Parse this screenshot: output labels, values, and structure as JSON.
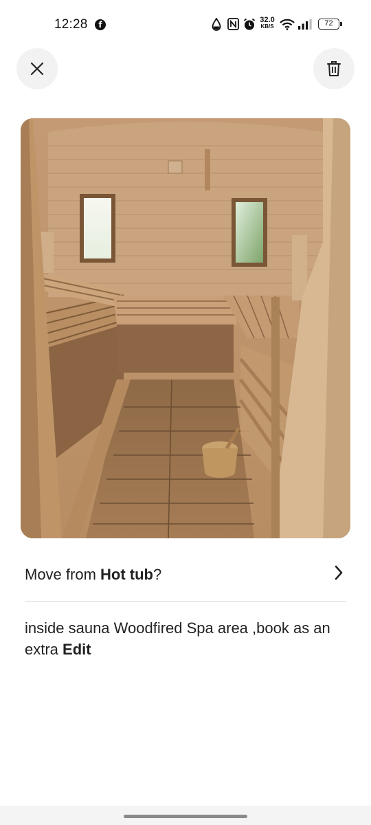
{
  "status_bar": {
    "time": "12:28",
    "app_icon": "facebook-icon",
    "net_speed_value": "32.0",
    "net_speed_unit": "KB/S",
    "battery": "72",
    "icons": [
      "water-drop-icon",
      "nfc-icon",
      "alarm-icon",
      "wifi-icon",
      "signal-icon",
      "battery-icon"
    ]
  },
  "toolbar": {
    "close_icon": "close-icon",
    "delete_icon": "trash-icon"
  },
  "photo": {
    "subject": "sauna-interior-photo"
  },
  "move": {
    "prefix": "Move from ",
    "room": "Hot tub",
    "suffix": "?",
    "chevron_icon": "chevron-right-icon"
  },
  "caption": {
    "text": "inside sauna Woodfired Spa area ,book as an extra ",
    "edit_label": "Edit"
  },
  "colors": {
    "text": "#222222",
    "divider": "#dddddd",
    "button_bg": "#f2f2f2"
  }
}
